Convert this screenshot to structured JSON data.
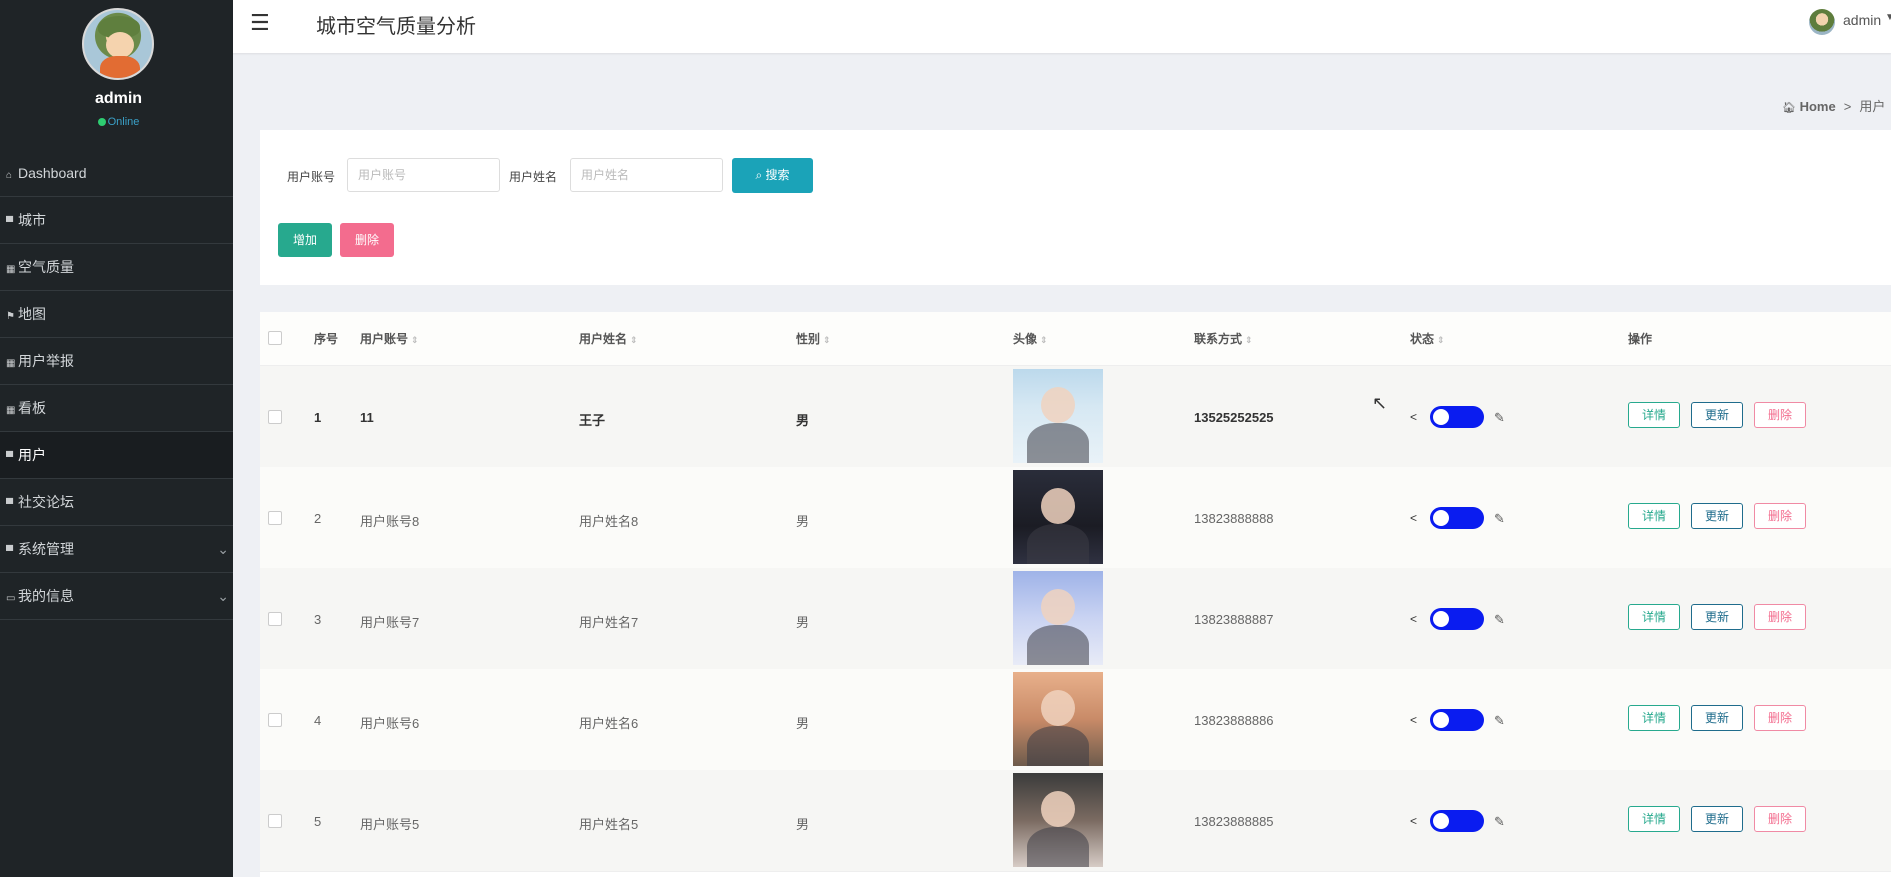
{
  "sidebar": {
    "username": "admin",
    "status": "Online",
    "items": [
      {
        "icon": "home-icon",
        "glyph": "⌂",
        "label": "Dashboard"
      },
      {
        "icon": "city-icon",
        "glyph": "▀",
        "label": "城市"
      },
      {
        "icon": "grid-icon",
        "glyph": "▦",
        "label": "空气质量"
      },
      {
        "icon": "flag-icon",
        "glyph": "⚑",
        "label": "地图"
      },
      {
        "icon": "grid-icon",
        "glyph": "▦",
        "label": "用户举报"
      },
      {
        "icon": "grid-icon",
        "glyph": "▦",
        "label": "看板"
      },
      {
        "icon": "chat-icon",
        "glyph": "▀",
        "label": "用户",
        "active": true
      },
      {
        "icon": "forum-icon",
        "glyph": "▀",
        "label": "社交论坛"
      },
      {
        "icon": "system-icon",
        "glyph": "▀",
        "label": "系统管理",
        "expandable": true
      },
      {
        "icon": "info-icon",
        "glyph": "▭",
        "label": "我的信息",
        "expandable": true
      }
    ]
  },
  "header": {
    "title": "城市空气质量分析",
    "user": "admin"
  },
  "breadcrumb": {
    "home": "Home",
    "separator": ">",
    "current": "用户"
  },
  "search": {
    "account_label": "用户账号",
    "account_placeholder": "用户账号",
    "name_label": "用户姓名",
    "name_placeholder": "用户姓名",
    "search_button": "搜索",
    "add_button": "增加",
    "delete_button": "删除"
  },
  "table": {
    "columns": [
      "序号",
      "用户账号",
      "用户姓名",
      "性别",
      "头像",
      "联系方式",
      "状态",
      "操作"
    ],
    "rows": [
      {
        "index": "1",
        "account": "11",
        "name": "王子",
        "gender": "男",
        "phone": "13525252525",
        "status_on": true
      },
      {
        "index": "2",
        "account": "用户账号8",
        "name": "用户姓名8",
        "gender": "男",
        "phone": "13823888888",
        "status_on": true
      },
      {
        "index": "3",
        "account": "用户账号7",
        "name": "用户姓名7",
        "gender": "男",
        "phone": "13823888887",
        "status_on": true
      },
      {
        "index": "4",
        "account": "用户账号6",
        "name": "用户姓名6",
        "gender": "男",
        "phone": "13823888886",
        "status_on": true
      },
      {
        "index": "5",
        "account": "用户账号5",
        "name": "用户姓名5",
        "gender": "男",
        "phone": "13823888885",
        "status_on": true
      }
    ],
    "actions": {
      "detail": "详情",
      "update": "更新",
      "delete": "删除"
    }
  },
  "colors": {
    "sidebar_bg": "#1f2427",
    "search_button": "#1ba3b8",
    "add_button": "#27a98e",
    "delete_button": "#f36c8e",
    "toggle_on": "#0a1cf0"
  }
}
